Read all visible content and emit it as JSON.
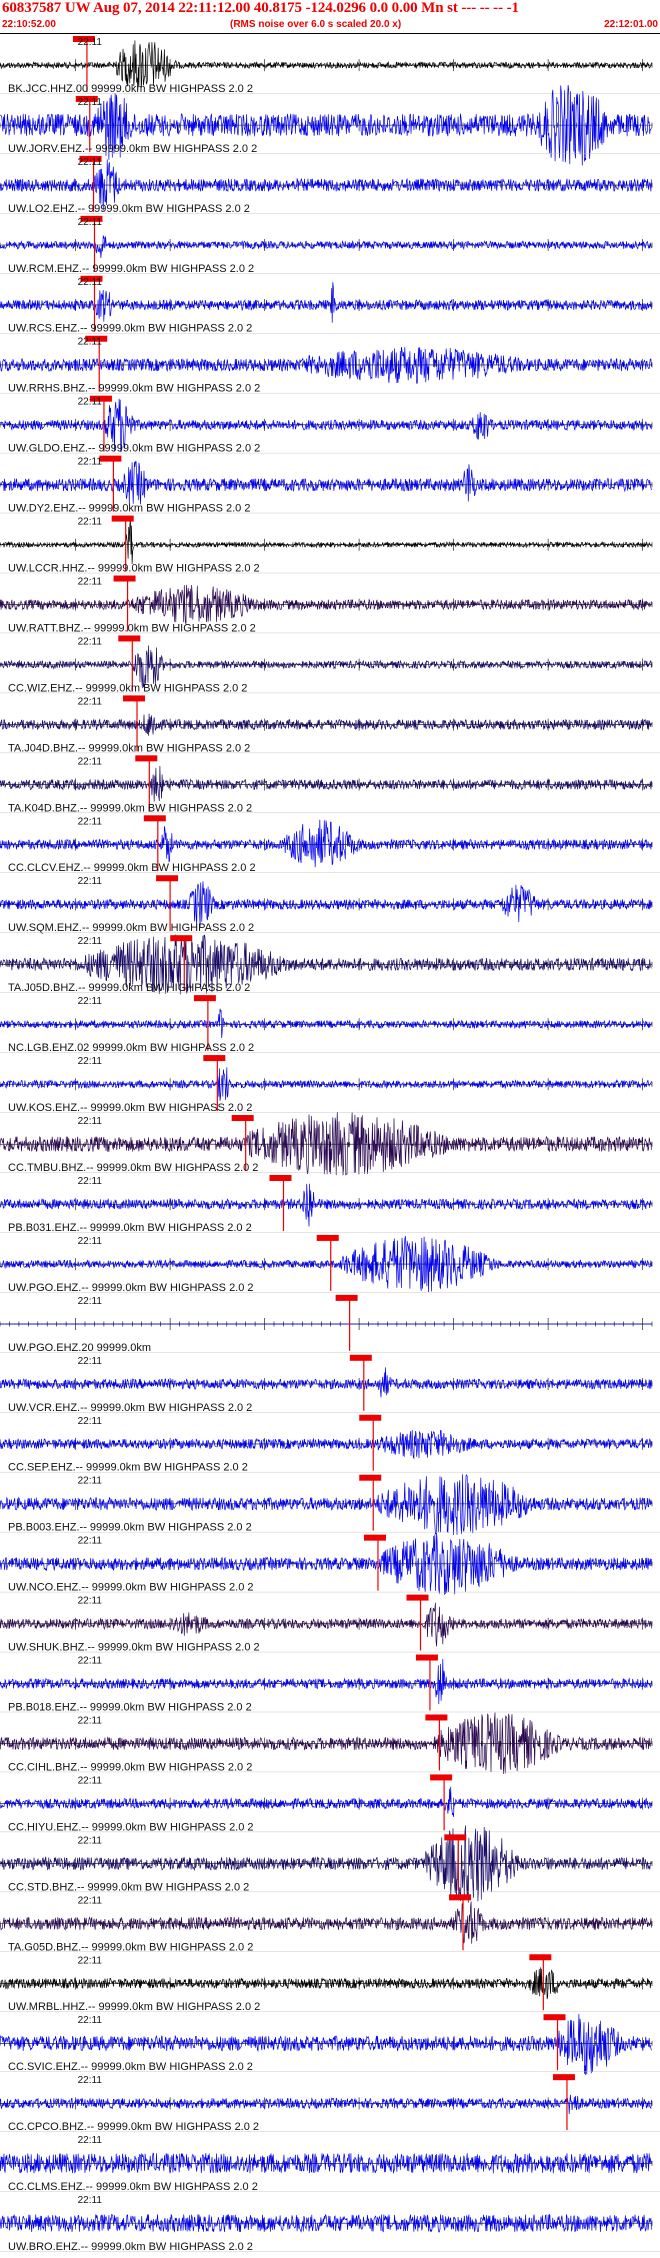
{
  "header": {
    "title": "60837587 UW Aug 07, 2014 22:11:12.00   40.8175 -124.0296  0.0 0.00 Mn st --- -- --  -1",
    "start_time": "22:10:52.00",
    "note": "(RMS noise over 6.0 s scaled 20.0 x)",
    "end_time": "22:12:01.00"
  },
  "colors": {
    "header": "#ee0000",
    "pick": "#ee0000",
    "trace_palette": [
      "#000000",
      "#0000ee",
      "#1a0a66",
      "#2a0850"
    ]
  },
  "chart_data": {
    "type": "line",
    "title": "60837587 UW Aug 07, 2014 22:11:12.00   40.8175 -124.0296  0.0 0.00 Mn st --- -- --  -1",
    "x_range": [
      "22:10:52.00",
      "22:12:01.00"
    ],
    "x_unit": "seconds after 22:10:52.00",
    "x_span_s": 69,
    "tick_label": "22:11",
    "rows": [
      {
        "label": "BK.JCC.HHZ.00 99999.0km BW  HIGHPASS  2.0  2",
        "pick_s": 9.2,
        "color": "#000000",
        "noise": 0.12,
        "bursts": [
          {
            "t": 12,
            "dur": 10,
            "amp": 1.0
          }
        ]
      },
      {
        "label": "UW.JORV.EHZ.-- 99999.0km BW  HIGHPASS  2.0  2",
        "pick_s": 9.5,
        "color": "#0000ee",
        "noise": 0.45,
        "bursts": [
          {
            "t": 10,
            "dur": 6,
            "amp": 1.0
          },
          {
            "t": 57,
            "dur": 11,
            "amp": 1.4
          }
        ]
      },
      {
        "label": "UW.LO2.EHZ.-- 99999.0km BW  HIGHPASS  2.0  2",
        "pick_s": 9.9,
        "color": "#0000ee",
        "noise": 0.25,
        "bursts": [
          {
            "t": 10,
            "dur": 4,
            "amp": 0.9
          }
        ]
      },
      {
        "label": "UW.RCM.EHZ.-- 99999.0km BW  HIGHPASS  2.0  2",
        "pick_s": 10.0,
        "color": "#0000ee",
        "noise": 0.15,
        "bursts": [
          {
            "t": 10,
            "dur": 2,
            "amp": 0.5
          }
        ]
      },
      {
        "label": "UW.RCS.EHZ.-- 99999.0km BW  HIGHPASS  2.0  2",
        "pick_s": 10.0,
        "color": "#0000ee",
        "noise": 0.2,
        "bursts": [
          {
            "t": 35,
            "dur": 1,
            "amp": 0.9
          },
          {
            "t": 10,
            "dur": 3,
            "amp": 0.5
          }
        ]
      },
      {
        "label": "UW.RRHS.BHZ.-- 99999.0km BW  HIGHPASS  2.0  2",
        "pick_s": 10.5,
        "color": "#0000ee",
        "noise": 0.25,
        "bursts": [
          {
            "t": 32,
            "dur": 35,
            "amp": 0.5
          }
        ]
      },
      {
        "label": "UW.GLDO.EHZ.-- 99999.0km BW  HIGHPASS  2.0  2",
        "pick_s": 11.0,
        "color": "#0000ee",
        "noise": 0.2,
        "bursts": [
          {
            "t": 11,
            "dur": 5,
            "amp": 1.0
          },
          {
            "t": 50,
            "dur": 3,
            "amp": 0.6
          }
        ]
      },
      {
        "label": "UW.DY2.EHZ.-- 99999.0km BW  HIGHPASS  2.0  2",
        "pick_s": 12.0,
        "color": "#0000ee",
        "noise": 0.25,
        "bursts": [
          {
            "t": 13,
            "dur": 4,
            "amp": 0.7
          },
          {
            "t": 49,
            "dur": 2,
            "amp": 0.8
          }
        ]
      },
      {
        "label": "UW.LCCR.HHZ.-- 99999.0km BW  HIGHPASS  2.0  2",
        "pick_s": 13.3,
        "color": "#000000",
        "noise": 0.1,
        "bursts": [
          {
            "t": 13.3,
            "dur": 1.5,
            "amp": 1.0
          }
        ]
      },
      {
        "label": "UW.RATT.BHZ.-- 99999.0km BW  HIGHPASS  2.0  2",
        "pick_s": 13.5,
        "color": "#2a0850",
        "noise": 0.2,
        "bursts": [
          {
            "t": 14,
            "dur": 20,
            "amp": 0.6
          }
        ]
      },
      {
        "label": "CC.WIZ.EHZ.-- 99999.0km BW  HIGHPASS  2.0  2",
        "pick_s": 14.0,
        "color": "#1a0a66",
        "noise": 0.15,
        "bursts": [
          {
            "t": 14,
            "dur": 5,
            "amp": 0.9
          }
        ]
      },
      {
        "label": "TA.J04D.BHZ.-- 99999.0km BW  HIGHPASS  2.0  2",
        "pick_s": 14.5,
        "color": "#1a0a66",
        "noise": 0.2,
        "bursts": [
          {
            "t": 15,
            "dur": 3,
            "amp": 0.4
          }
        ]
      },
      {
        "label": "TA.K04D.BHZ.-- 99999.0km BW  HIGHPASS  2.0  2",
        "pick_s": 15.8,
        "color": "#1a0a66",
        "noise": 0.2,
        "bursts": [
          {
            "t": 16,
            "dur": 2,
            "amp": 0.7
          }
        ]
      },
      {
        "label": "CC.CLCV.EHZ.-- 99999.0km BW  HIGHPASS  2.0  2",
        "pick_s": 16.7,
        "color": "#0000ee",
        "noise": 0.2,
        "bursts": [
          {
            "t": 17,
            "dur": 2,
            "amp": 0.7
          },
          {
            "t": 30,
            "dur": 12,
            "amp": 0.8
          }
        ]
      },
      {
        "label": "UW.SQM.EHZ.-- 99999.0km BW  HIGHPASS  2.0  2",
        "pick_s": 18.0,
        "color": "#0000ee",
        "noise": 0.2,
        "bursts": [
          {
            "t": 20,
            "dur": 4,
            "amp": 0.8
          },
          {
            "t": 53,
            "dur": 6,
            "amp": 0.6
          }
        ]
      },
      {
        "label": "TA.J05D.BHZ.-- 99999.0km BW  HIGHPASS  2.0  2",
        "pick_s": 19.5,
        "color": "#1a0a66",
        "noise": 0.25,
        "bursts": [
          {
            "t": 9,
            "dur": 32,
            "amp": 1.0
          }
        ]
      },
      {
        "label": "NC.LGB.EHZ.02 99999.0km BW  HIGHPASS  2.0  2",
        "pick_s": 22.0,
        "color": "#0000ee",
        "noise": 0.15,
        "bursts": [
          {
            "t": 23,
            "dur": 1,
            "amp": 0.6
          }
        ]
      },
      {
        "label": "UW.KOS.EHZ.-- 99999.0km BW  HIGHPASS  2.0  2",
        "pick_s": 23.0,
        "color": "#0000ee",
        "noise": 0.15,
        "bursts": [
          {
            "t": 23,
            "dur": 2,
            "amp": 0.8
          }
        ]
      },
      {
        "label": "CC.TMBU.BHZ.-- 99999.0km BW  HIGHPASS  2.0  2",
        "pick_s": 26.0,
        "color": "#2a0850",
        "noise": 0.3,
        "bursts": [
          {
            "t": 26,
            "dur": 32,
            "amp": 1.0
          }
        ]
      },
      {
        "label": "PB.B031.EHZ.-- 99999.0km BW  HIGHPASS  2.0  2",
        "pick_s": 30.0,
        "color": "#0000ee",
        "noise": 0.2,
        "bursts": [
          {
            "t": 32,
            "dur": 2,
            "amp": 1.0
          }
        ]
      },
      {
        "label": "UW.PGO.EHZ.-- 99999.0km BW  HIGHPASS  2.0  2",
        "pick_s": 35.0,
        "color": "#0000ee",
        "noise": 0.15,
        "bursts": [
          {
            "t": 36,
            "dur": 25,
            "amp": 1.0
          }
        ]
      },
      {
        "label": "UW.PGO.EHZ.20 99999.0km",
        "pick_s": 37.0,
        "color": "#0000ee",
        "noise": 0.0,
        "bursts": []
      },
      {
        "label": "UW.VCR.EHZ.-- 99999.0km BW  HIGHPASS  2.0  2",
        "pick_s": 38.5,
        "color": "#0000ee",
        "noise": 0.2,
        "bursts": [
          {
            "t": 40,
            "dur": 2,
            "amp": 0.5
          }
        ]
      },
      {
        "label": "CC.SEP.EHZ.-- 99999.0km BW  HIGHPASS  2.0  2",
        "pick_s": 39.5,
        "color": "#0000ee",
        "noise": 0.2,
        "bursts": [
          {
            "t": 40,
            "dur": 15,
            "amp": 0.4
          }
        ]
      },
      {
        "label": "PB.B003.EHZ.-- 99999.0km BW  HIGHPASS  2.0  2",
        "pick_s": 39.5,
        "color": "#0000ee",
        "noise": 0.25,
        "bursts": [
          {
            "t": 40,
            "dur": 25,
            "amp": 1.0
          }
        ]
      },
      {
        "label": "UW.NCO.EHZ.-- 99999.0km BW  HIGHPASS  2.0  2",
        "pick_s": 40.0,
        "color": "#0000ee",
        "noise": 0.25,
        "bursts": [
          {
            "t": 40,
            "dur": 22,
            "amp": 1.0
          }
        ]
      },
      {
        "label": "UW.SHUK.BHZ.-- 99999.0km BW  HIGHPASS  2.0  2",
        "pick_s": 44.5,
        "color": "#2a0850",
        "noise": 0.2,
        "bursts": [
          {
            "t": 45,
            "dur": 4,
            "amp": 0.8
          },
          {
            "t": 18,
            "dur": 6,
            "amp": 0.3
          }
        ]
      },
      {
        "label": "PB.B018.EHZ.-- 99999.0km BW  HIGHPASS  2.0  2",
        "pick_s": 45.5,
        "color": "#0000ee",
        "noise": 0.2,
        "bursts": [
          {
            "t": 46,
            "dur": 2,
            "amp": 1.0
          }
        ]
      },
      {
        "label": "CC.CIHL.BHZ.-- 99999.0km BW  HIGHPASS  2.0  2",
        "pick_s": 46.5,
        "color": "#2a0850",
        "noise": 0.25,
        "bursts": [
          {
            "t": 46,
            "dur": 20,
            "amp": 1.0
          }
        ]
      },
      {
        "label": "CC.HIYU.EHZ.-- 99999.0km BW  HIGHPASS  2.0  2",
        "pick_s": 47.0,
        "color": "#0000ee",
        "noise": 0.2,
        "bursts": [
          {
            "t": 47,
            "dur": 2,
            "amp": 0.5
          }
        ]
      },
      {
        "label": "CC.STD.BHZ.-- 99999.0km BW  HIGHPASS  2.0  2",
        "pick_s": 48.5,
        "color": "#1a0a66",
        "noise": 0.25,
        "bursts": [
          {
            "t": 45,
            "dur": 15,
            "amp": 1.4
          }
        ]
      },
      {
        "label": "TA.G05D.BHZ.-- 99999.0km BW  HIGHPASS  2.0  2",
        "pick_s": 49.0,
        "color": "#2a0850",
        "noise": 0.25,
        "bursts": [
          {
            "t": 48,
            "dur": 5,
            "amp": 0.7
          }
        ]
      },
      {
        "label": "UW.MRBL.HHZ.-- 99999.0km BW  HIGHPASS  2.0  2",
        "pick_s": 57.5,
        "color": "#000000",
        "noise": 0.2,
        "bursts": [
          {
            "t": 56,
            "dur": 5,
            "amp": 0.5
          }
        ]
      },
      {
        "label": "CC.SVIC.EHZ.-- 99999.0km BW  HIGHPASS  2.0  2",
        "pick_s": 59.0,
        "color": "#0000ee",
        "noise": 0.3,
        "bursts": [
          {
            "t": 59,
            "dur": 10,
            "amp": 1.0
          }
        ]
      },
      {
        "label": "CC.CPCO.BHZ.-- 99999.0km BW  HIGHPASS  2.0  2",
        "pick_s": 60.0,
        "color": "#0000ee",
        "noise": 0.2,
        "bursts": [
          {
            "t": 60,
            "dur": 2,
            "amp": 0.4
          }
        ]
      },
      {
        "label": "CC.CLMS.EHZ.-- 99999.0km BW  HIGHPASS  2.0  2",
        "pick_s": null,
        "color": "#0000ee",
        "noise": 0.4,
        "bursts": []
      },
      {
        "label": "UW.BRO.EHZ.-- 99999.0km BW  HIGHPASS  2.0  2",
        "pick_s": null,
        "color": "#0000ee",
        "noise": 0.35,
        "bursts": []
      }
    ]
  }
}
